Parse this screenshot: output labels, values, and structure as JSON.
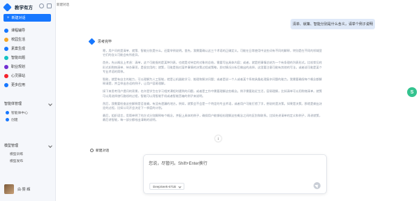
{
  "app": {
    "name": "教学有方",
    "tab_title": "新建对话"
  },
  "sidebar": {
    "new_chat_label": "新建对话",
    "nav_items": [
      {
        "label": "课程辅导",
        "color": "#1677ff"
      },
      {
        "label": "校园生活",
        "color": "#f5a623"
      },
      {
        "label": "素案生成",
        "color": "#1677ff"
      },
      {
        "label": "智能出题",
        "color": "#13c2c2"
      },
      {
        "label": "职业规划",
        "color": "#722ed1"
      },
      {
        "label": "心灵驿站",
        "color": "#f5222d"
      },
      {
        "label": "更多应用",
        "color": "#1677ff"
      }
    ],
    "section_knowledge": {
      "title": "智能体管理",
      "items": [
        {
          "label": "智能体中心",
          "color": "#1677ff"
        },
        {
          "label": "创建",
          "color": "#1677ff"
        }
      ]
    },
    "section_model": {
      "title": "模型管理",
      "items": [
        {
          "label": "模型训练"
        },
        {
          "label": "模型发布"
        }
      ]
    },
    "user_name": "白·赞·辉"
  },
  "chat": {
    "user_message": "清单、就策、智能分别是什么含义，请举个例子说明",
    "thinking_label": "思考完毕",
    "paragraphs": [
      "嗯，用户问的是清单、就策、智能分别是什么，还要举例说明。首先，我需要确认这三个术语的正确定义。可能在日常使用中这些词有不同的解释，特别是在不同的领域里它们的含义可能会有所差异。",
      "首先，先从概念上考虑：清单，这个可能指的是某种列表，也就是对待定的对象的总结，需要写出具体内容；或者，就是把事情总结为一个有条理的列表形式。比较常见的形式如购物清单、待办事项，是很实用的；就策，可能是指对某件事情的决策过程或策略，即对情况分析后做出的选择，这里要注意可能有其他的写法，或者说可能是某个专业术语的简称。",
      "智能，就是有自主的能力，可以理解为人工智能，就是让机器能学习、推理和解决问题；或者是说一个人或者某个系统具备处理复杂问题的能力。我需要确保每个概念都解释清楚，并且举出合适的例子，让用户容易理解。",
      "接下来思考用户提问的背景，也许是学生在学习相关课程时遇到的问题，或者是工作中需要理解这些概念。例子需要贴近生活，容易理解，比如清单可以用购物清单，就策可以用选择旅行路线的过程，智能可以用智能手机或者智能音箱的例子来说明。",
      "然后，我需要检查这些解释是否准确，有没有遗漏的地方。例如，就策会不会是一个特定的专业术语，或者用户可能打错了字，想说的是决策。如果是决策，那就是做出决定的过程，比如公司开会决定下一季度的计划。",
      "最后，组织语言，用简单明了的方式分别解释每个概念，并配上具体的例子，确保用户能够轻松理解这些概念之间的区别和联系。比如先讲清单的定义和例子，再讲就策，最后讲智能，每一部分都给出清晰的说明。"
    ],
    "new_conversation_label": "新建对话",
    "scroll_down_glyph": "↓"
  },
  "input": {
    "placeholder": "您说，尽管问。Shift+Enter换行",
    "value": "",
    "model_label": "DeepSeek-671B"
  },
  "float_badge_glyph": "S"
}
